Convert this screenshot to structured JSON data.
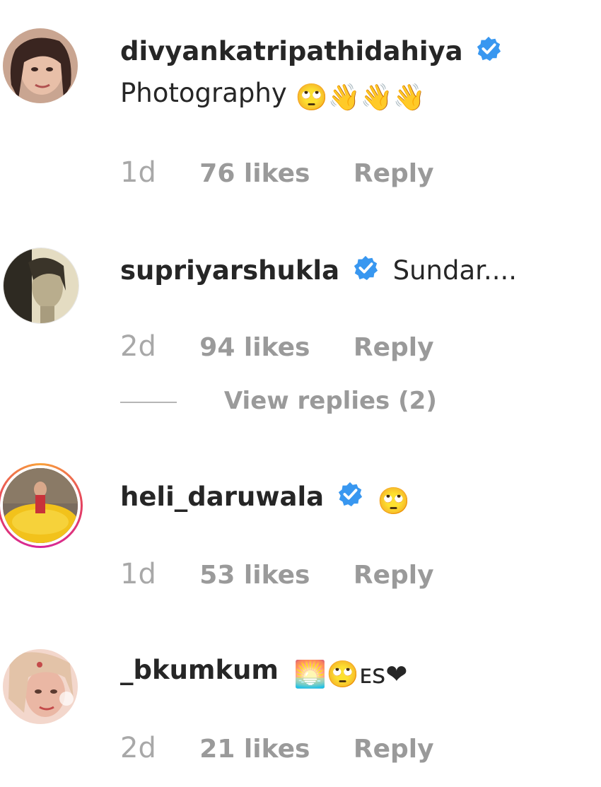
{
  "comments": [
    {
      "username": "divyankatripathidahiya",
      "verified": true,
      "text": "Photography",
      "emojis": "🙄👋👋👋",
      "time": "1d",
      "likes": "76 likes",
      "reply": "Reply",
      "avatar_colors": [
        "#b98a77",
        "#3a2520"
      ]
    },
    {
      "username": "supriyarshukla",
      "verified": true,
      "text": "Sundar....",
      "time": "2d",
      "likes": "94 likes",
      "reply": "Reply",
      "view_replies": "View replies (2)",
      "avatar_colors": [
        "#d9d0b4",
        "#2e2a22"
      ]
    },
    {
      "username": "heli_daruwala",
      "verified": true,
      "text": "🙄",
      "time": "1d",
      "likes": "53 likes",
      "reply": "Reply",
      "story_ring": true,
      "avatar_colors": [
        "#f2c21b",
        "#6b5a4a"
      ]
    },
    {
      "username": "_bkumkum",
      "verified": false,
      "text": "🌅🙄ᴇs❤",
      "time": "2d",
      "likes": "21 likes",
      "reply": "Reply",
      "avatar_colors": [
        "#f0c2b5",
        "#c44a4a"
      ]
    }
  ],
  "colors": {
    "verified_blue": "#3897f0",
    "meta_gray": "#9a9a9a",
    "text_dark": "#262626"
  }
}
